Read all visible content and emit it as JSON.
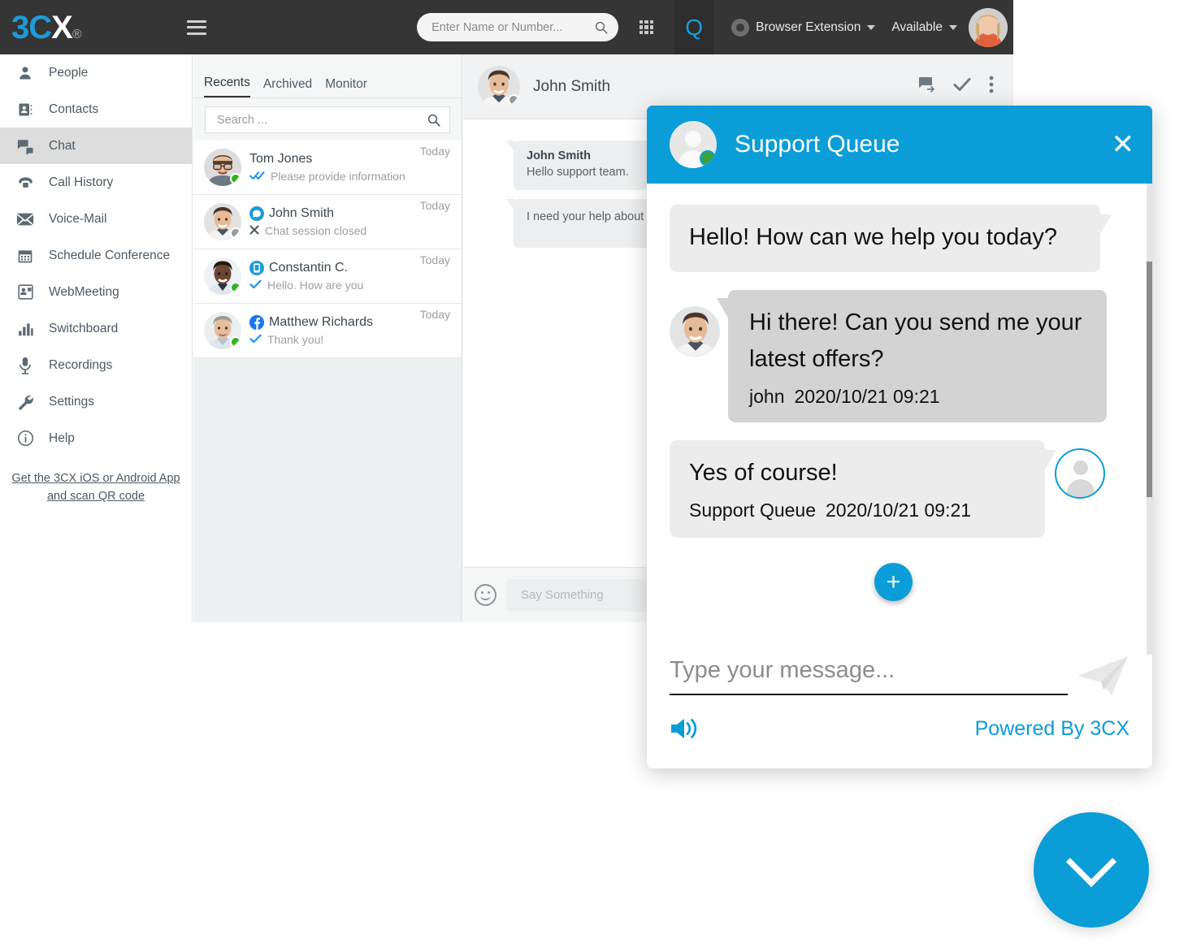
{
  "topbar": {
    "logo_3": "3C",
    "logo_x": "X",
    "logo_dot": "®",
    "search_placeholder": "Enter Name or Number...",
    "search_value": "",
    "queue_letter": "Q",
    "browser_extension": "Browser Extension",
    "status": "Available"
  },
  "sidebar": {
    "items": [
      {
        "label": "People",
        "icon": "person-icon",
        "active": false
      },
      {
        "label": "Contacts",
        "icon": "contacts-book-icon",
        "active": false
      },
      {
        "label": "Chat",
        "icon": "chat-bubbles-icon",
        "active": true
      },
      {
        "label": "Call History",
        "icon": "telephone-icon",
        "active": false
      },
      {
        "label": "Voice-Mail",
        "icon": "envelope-icon",
        "active": false
      },
      {
        "label": "Schedule Conference",
        "icon": "calendar-icon",
        "active": false
      },
      {
        "label": "WebMeeting",
        "icon": "webmeeting-icon",
        "active": false
      },
      {
        "label": "Switchboard",
        "icon": "bar-chart-icon",
        "active": false
      },
      {
        "label": "Recordings",
        "icon": "microphone-icon",
        "active": false
      },
      {
        "label": "Settings",
        "icon": "wrench-icon",
        "active": false
      },
      {
        "label": "Help",
        "icon": "info-circle-icon",
        "active": false
      }
    ],
    "promo_link": "Get the 3CX iOS or Android App and scan QR code"
  },
  "chat_list": {
    "tabs": [
      {
        "label": "Recents",
        "active": true
      },
      {
        "label": "Archived",
        "active": false
      },
      {
        "label": "Monitor",
        "active": false
      }
    ],
    "search_placeholder": "Search ...",
    "search_value": "",
    "conversations": [
      {
        "name": "Tom Jones",
        "time": "Today",
        "preview": "Please provide information",
        "presence": "online",
        "tick": "double-check-icon",
        "badge": ""
      },
      {
        "name": "John Smith",
        "time": "Today",
        "preview": "Chat session closed",
        "presence": "offline",
        "tick": "close-x-icon",
        "badge": "livechat"
      },
      {
        "name": "Constantin C.",
        "time": "Today",
        "preview": "Hello. How are you",
        "presence": "online",
        "tick": "single-check-icon",
        "badge": "sms"
      },
      {
        "name": "Matthew Richards",
        "time": "Today",
        "preview": "Thank you!",
        "presence": "online",
        "tick": "single-check-icon",
        "badge": "facebook"
      }
    ]
  },
  "chat_pane": {
    "contact_name": "John Smith",
    "actions": [
      "transfer-chat-icon",
      "resolve-check-icon",
      "more-options-icon"
    ],
    "messages": [
      {
        "sender": "John Smith",
        "text": "Hello support team.",
        "show_sender": true
      },
      {
        "sender": "John Smith",
        "text": "I need your help about",
        "show_sender": false
      }
    ],
    "composer_placeholder": "Say Something",
    "composer_value": "",
    "add_button": "+"
  },
  "widget": {
    "title": "Support Queue",
    "close_label": "✕",
    "messages": [
      {
        "side": "agent",
        "text": "Hello! How can we help you today?",
        "author": "",
        "timestamp": ""
      },
      {
        "side": "visitor",
        "text": "Hi there! Can you send me your latest offers?",
        "author": "john",
        "timestamp": "2020/10/21 09:21"
      },
      {
        "side": "agent",
        "text": "Yes of course!",
        "author": "Support Queue",
        "timestamp": "2020/10/21 09:21"
      }
    ],
    "input_placeholder": "Type your message...",
    "input_value": "",
    "powered_by": "Powered By 3CX",
    "sound_icon": "speaker-icon",
    "send_icon": "paper-plane-icon"
  },
  "launcher": {
    "icon": "chevron-down-icon"
  },
  "colors": {
    "brand_blue": "#0b9dd8",
    "topbar_dark": "#353535",
    "online_green": "#2fb51e",
    "bubble_agent": "#ececec",
    "bubble_visitor": "#d3d3d3"
  }
}
